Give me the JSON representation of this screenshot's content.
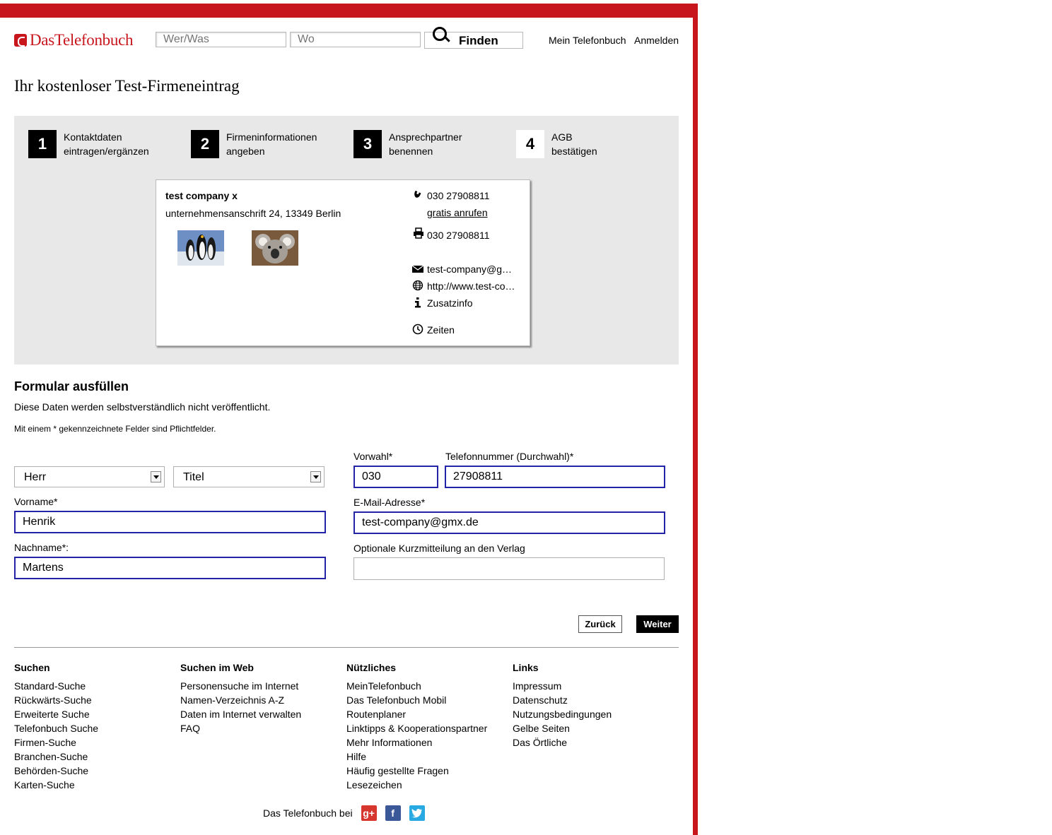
{
  "header": {
    "logo_text": "DasTelefonbuch",
    "search_what_placeholder": "Wer/Was",
    "search_where_placeholder": "Wo",
    "find_label": "Finden",
    "my_phonebook": "Mein Telefonbuch",
    "login": "Anmelden"
  },
  "page_title": "Ihr kostenloser Test-Firmeneintrag",
  "steps": [
    {
      "num": "1",
      "line1": "Kontaktdaten",
      "line2": "eintragen/ergänzen"
    },
    {
      "num": "2",
      "line1": "Firmeninformationen",
      "line2": "angeben"
    },
    {
      "num": "3",
      "line1": "Ansprechpartner",
      "line2": "benennen"
    },
    {
      "num": "4",
      "line1": "AGB",
      "line2": "bestätigen"
    }
  ],
  "preview_card": {
    "company": "test company x",
    "address": "unternehmensanschrift 24, 13349 Berlin",
    "phone": "030 27908811",
    "call_free": "gratis anrufen",
    "fax": "030 27908811",
    "email": "test-company@g…",
    "web": "http://www.test-co…",
    "extra_info": "Zusatzinfo",
    "hours": "Zeiten"
  },
  "form": {
    "title": "Formular ausfüllen",
    "note": "Diese Daten werden selbstverständlich nicht veröffentlicht.",
    "required_note": "Mit einem * gekennzeichnete Felder sind Pflichtfelder.",
    "salutation": "Herr",
    "title_select": "Titel",
    "area_code_label": "Vorwahl*",
    "area_code": "030",
    "phone_label": "Telefonnummer (Durchwahl)*",
    "phone": "27908811",
    "firstname_label": "Vorname*",
    "firstname": "Henrik",
    "email_label": "E-Mail-Adresse*",
    "email": "test-company@gmx.de",
    "lastname_label": "Nachname*:",
    "lastname": "Martens",
    "message_label": "Optionale Kurzmitteilung an den Verlag",
    "message": "",
    "back_label": "Zurück",
    "next_label": "Weiter"
  },
  "footer": {
    "columns": [
      {
        "heading": "Suchen",
        "items": [
          "Standard-Suche",
          "Rückwärts-Suche",
          "Erweiterte Suche",
          "Telefonbuch Suche",
          "Firmen-Suche",
          "Branchen-Suche",
          "Behörden-Suche",
          "Karten-Suche"
        ]
      },
      {
        "heading": "Suchen im Web",
        "items": [
          "Personensuche im Internet",
          "Namen-Verzeichnis A-Z",
          "Daten im Internet verwalten",
          "FAQ"
        ]
      },
      {
        "heading": "Nützliches",
        "items": [
          "MeinTelefonbuch",
          "Das Telefonbuch Mobil",
          "Routenplaner",
          "Linktipps & Kooperationspartner",
          "Mehr Informationen",
          "Hilfe",
          "Häufig gestellte Fragen",
          "Lesezeichen"
        ]
      },
      {
        "heading": "Links",
        "items": [
          "Impressum",
          "Datenschutz",
          "Nutzungsbedingungen",
          "Gelbe Seiten",
          "Das Örtliche"
        ]
      }
    ],
    "social_text": "Das Telefonbuch bei",
    "social_icons": [
      "google-plus-icon",
      "facebook-icon",
      "twitter-icon"
    ]
  },
  "colors": {
    "brand_red": "#c8161d",
    "focus_blue": "#2323a8",
    "panel_gray": "#e8e8e8"
  }
}
